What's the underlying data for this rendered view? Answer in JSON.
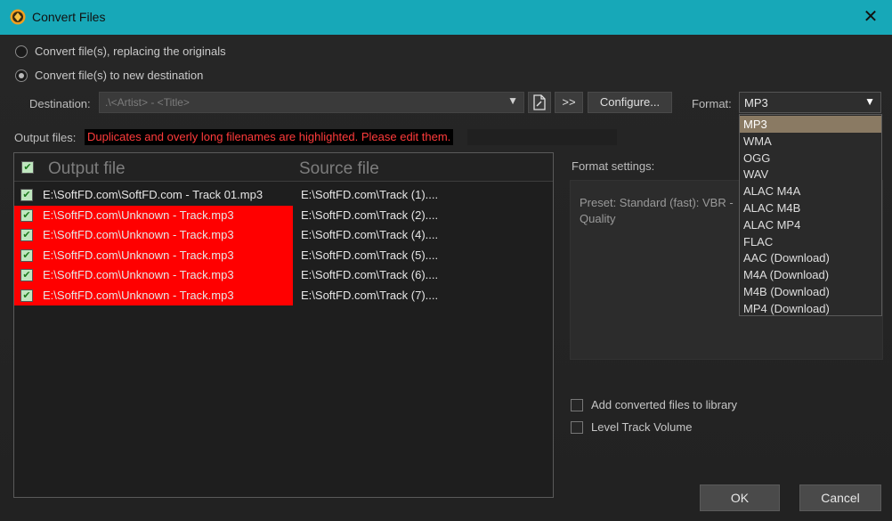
{
  "window": {
    "title": "Convert Files"
  },
  "options": {
    "replace_label": "Convert file(s), replacing the originals",
    "new_dest_label": "Convert file(s) to new destination"
  },
  "destination": {
    "label": "Destination:",
    "value": ".\\<Artist> - <Title>",
    "browse_button": ">>",
    "configure_button": "Configure..."
  },
  "format": {
    "label": "Format:",
    "selected": "MP3",
    "options": [
      "MP3",
      "WMA",
      "OGG",
      "WAV",
      "ALAC M4A",
      "ALAC M4B",
      "ALAC MP4",
      "FLAC",
      "AAC (Download)",
      "M4A (Download)",
      "M4B (Download)",
      "MP4 (Download)"
    ]
  },
  "output_files": {
    "label": "Output files:",
    "warning": "Duplicates and overly long filenames are highlighted. Please edit them.",
    "columns": {
      "output": "Output file",
      "source": "Source file"
    },
    "rows": [
      {
        "output": "E:\\SoftFD.com\\SoftFD.com - Track 01.mp3",
        "source": "E:\\SoftFD.com\\Track (1)....",
        "highlight": false
      },
      {
        "output": "E:\\SoftFD.com\\Unknown - Track.mp3",
        "source": "E:\\SoftFD.com\\Track (2)....",
        "highlight": true
      },
      {
        "output": "E:\\SoftFD.com\\Unknown - Track.mp3",
        "source": "E:\\SoftFD.com\\Track (4)....",
        "highlight": true
      },
      {
        "output": "E:\\SoftFD.com\\Unknown - Track.mp3",
        "source": "E:\\SoftFD.com\\Track (5)....",
        "highlight": true
      },
      {
        "output": "E:\\SoftFD.com\\Unknown - Track.mp3",
        "source": "E:\\SoftFD.com\\Track (6)....",
        "highlight": true
      },
      {
        "output": "E:\\SoftFD.com\\Unknown - Track.mp3",
        "source": "E:\\SoftFD.com\\Track (7)....",
        "highlight": true
      }
    ]
  },
  "format_settings": {
    "label": "Format settings:",
    "description": "Preset: Standard (fast): VBR - Quality"
  },
  "checkboxes": {
    "add_to_library": "Add converted files to library",
    "level_volume": "Level Track Volume"
  },
  "buttons": {
    "ok": "OK",
    "cancel": "Cancel"
  },
  "colors": {
    "titlebar": "#17a8b8",
    "highlight": "#ff0000",
    "selected_item": "#8a7a63"
  }
}
